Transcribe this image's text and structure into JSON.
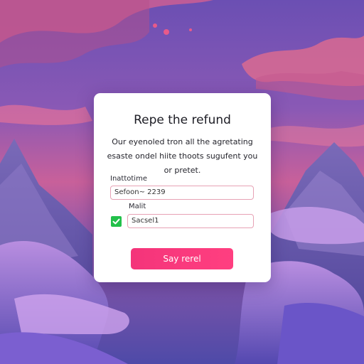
{
  "dialog": {
    "title": "Repe the refund",
    "description": "Our eyenoled tron all the agretating esaste ondel hiite thoots sugufent you or pretet."
  },
  "form": {
    "field1_label": "Inattotime",
    "field1_value": "Sefoon~ 2239",
    "field2_label": "Malit",
    "field2_value": "Sacsel1",
    "checkbox_checked": true
  },
  "submit_label": "Say rerel",
  "colors": {
    "accent": "#f4347a",
    "checkbox": "#22c04a",
    "field_border": "#e7a2b5"
  }
}
